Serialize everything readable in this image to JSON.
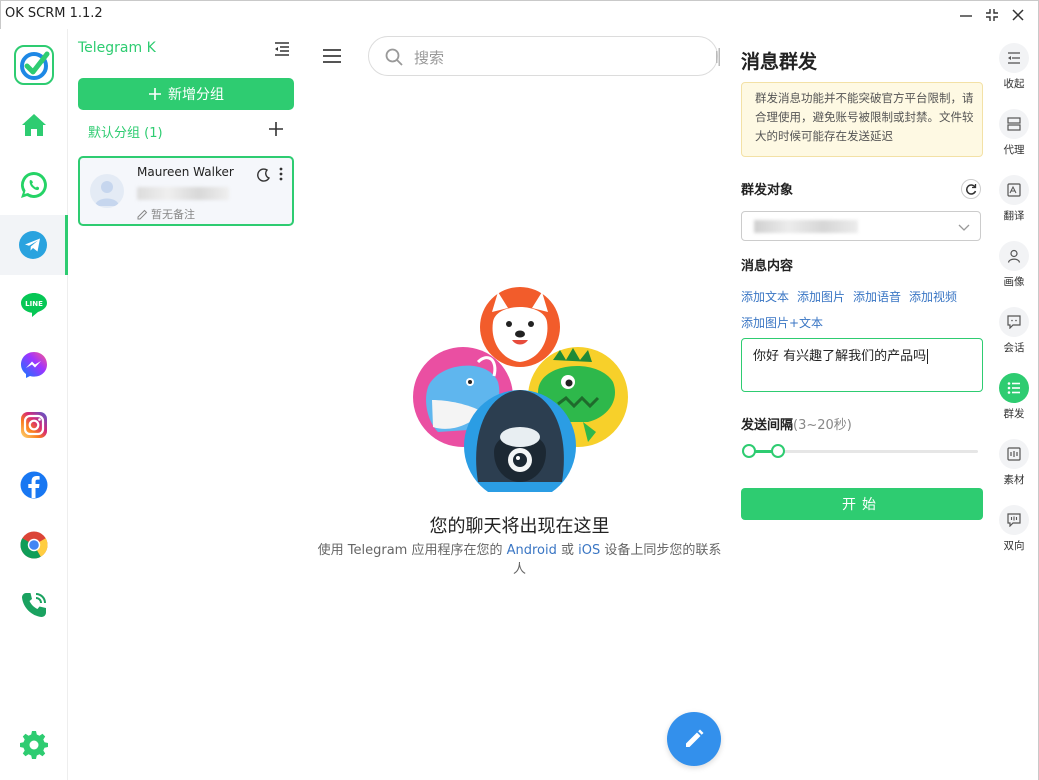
{
  "window": {
    "title": "OK SCRM 1.1.2"
  },
  "rail": {
    "items": [
      {
        "name": "home"
      },
      {
        "name": "whatsapp"
      },
      {
        "name": "telegram",
        "active": true
      },
      {
        "name": "line"
      },
      {
        "name": "messenger"
      },
      {
        "name": "instagram"
      },
      {
        "name": "facebook"
      },
      {
        "name": "chrome"
      },
      {
        "name": "phone"
      },
      {
        "name": "settings"
      }
    ],
    "line_badge": "LINE"
  },
  "groups": {
    "account_title": "Telegram K",
    "add_group_label": "新增分组",
    "default_group_label": "默认分组 (1)",
    "contact": {
      "name": "Maureen Walker",
      "note": "暂无备注"
    }
  },
  "chat": {
    "search_placeholder": "搜索",
    "empty_title": "您的聊天将出现在这里",
    "empty_sub_1": "使用 Telegram 应用程序在您的 ",
    "empty_sub_android": "Android",
    "empty_sub_or": " 或 ",
    "empty_sub_ios": "iOS",
    "empty_sub_2": " 设备上同步您的联系人"
  },
  "panel": {
    "title": "消息群发",
    "warning": "群发消息功能并不能突破官方平台限制，请合理使用，避免账号被限制或封禁。文件较大的时候可能存在发送延迟",
    "target_label": "群发对象",
    "content_label": "消息内容",
    "add_links": [
      "添加文本",
      "添加图片",
      "添加语音",
      "添加视频",
      "添加图片+文本"
    ],
    "message": "你好 有兴趣了解我们的产品吗",
    "interval_label": "发送间隔",
    "interval_hint": "(3~20秒)",
    "interval_range": {
      "min": 3,
      "max": 20,
      "low": 3,
      "high": 4
    },
    "start_label": "开始"
  },
  "tools": [
    {
      "label": "收起"
    },
    {
      "label": "代理"
    },
    {
      "label": "翻译"
    },
    {
      "label": "画像"
    },
    {
      "label": "会话"
    },
    {
      "label": "群发",
      "active": true
    },
    {
      "label": "素材"
    },
    {
      "label": "双向"
    }
  ],
  "colors": {
    "accent": "#2ecc71",
    "link": "#3a76c4",
    "telegram_blue": "#3390ec"
  }
}
